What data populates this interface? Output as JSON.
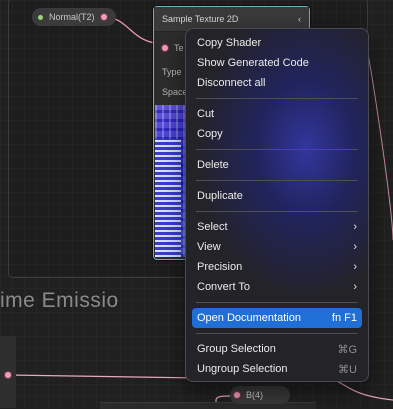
{
  "canvas": {
    "section_title": "ime Emission",
    "property_pill_label": "Normal(T2)",
    "b4_pill_label": "B(4)"
  },
  "node": {
    "title": "Sample Texture 2D",
    "collapse_glyph": "‹",
    "input_label": "Te",
    "type_label": "Type",
    "space_label": "Space"
  },
  "context_menu": {
    "groups": [
      [
        {
          "label": "Copy Shader"
        },
        {
          "label": "Show Generated Code"
        },
        {
          "label": "Disconnect all"
        }
      ],
      [
        {
          "label": "Cut"
        },
        {
          "label": "Copy"
        }
      ],
      [
        {
          "label": "Delete"
        }
      ],
      [
        {
          "label": "Duplicate"
        }
      ],
      [
        {
          "label": "Select",
          "submenu": true
        },
        {
          "label": "View",
          "submenu": true
        },
        {
          "label": "Precision",
          "submenu": true
        },
        {
          "label": "Convert To",
          "submenu": true
        }
      ],
      [
        {
          "label": "Open Documentation",
          "shortcut": "fn F1",
          "highlighted": true
        }
      ],
      [
        {
          "label": "Group Selection",
          "shortcut": "⌘G"
        },
        {
          "label": "Ungroup Selection",
          "shortcut": "⌘U"
        }
      ]
    ],
    "submenu_glyph": "›",
    "colors": {
      "highlight": "#1f6fd6",
      "accent_glow": "#3438aa"
    }
  },
  "colors": {
    "node_outline": "#6fb0c2",
    "wire": "#f09bb5",
    "property_dot": "#9bd47c"
  }
}
